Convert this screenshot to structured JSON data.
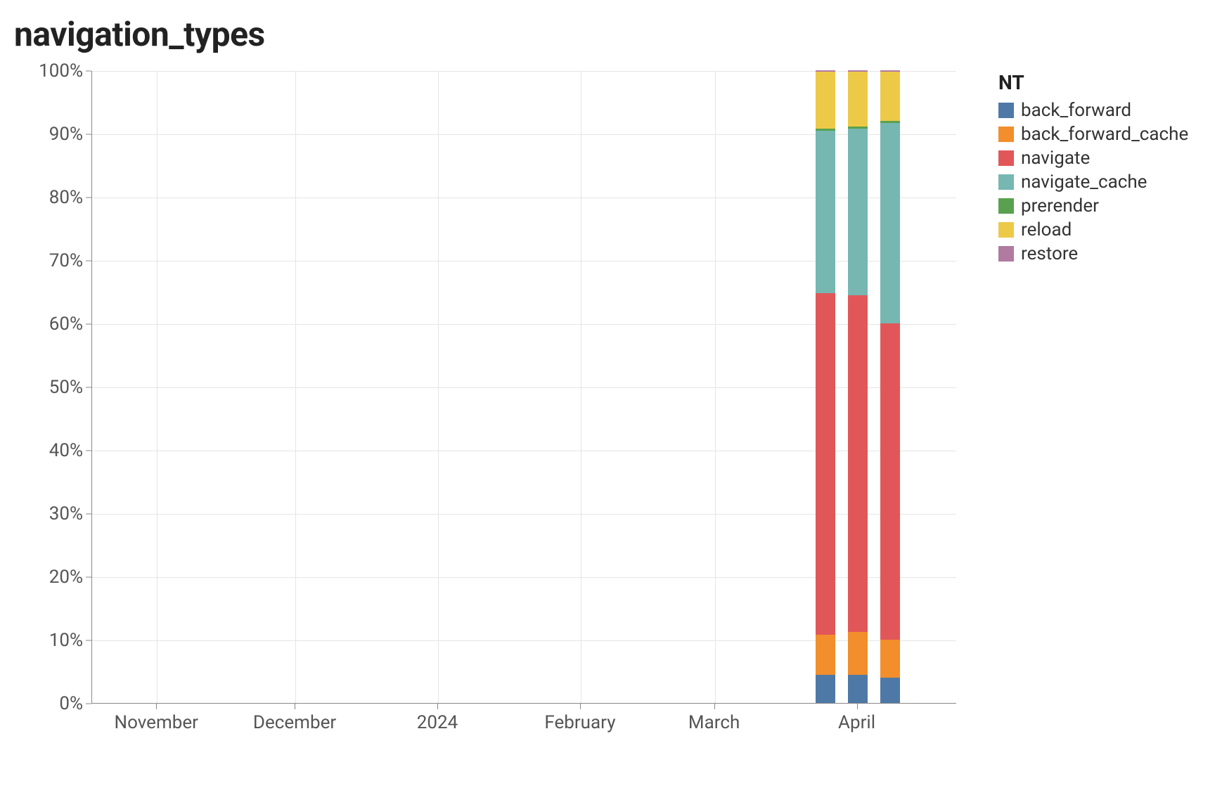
{
  "chart_data": {
    "type": "bar",
    "title": "navigation_types",
    "ylabel": "",
    "xlabel": "",
    "ylim": [
      0,
      100
    ],
    "y_ticks": [
      0,
      10,
      20,
      30,
      40,
      50,
      60,
      70,
      80,
      90,
      100
    ],
    "y_tick_labels": [
      "0%",
      "10%",
      "20%",
      "30%",
      "40%",
      "50%",
      "60%",
      "70%",
      "80%",
      "90%",
      "100%"
    ],
    "x_ticks": [
      {
        "pos": 0.075,
        "label": "November"
      },
      {
        "pos": 0.235,
        "label": "December"
      },
      {
        "pos": 0.4,
        "label": "2024"
      },
      {
        "pos": 0.565,
        "label": "February"
      },
      {
        "pos": 0.72,
        "label": "March"
      },
      {
        "pos": 0.885,
        "label": "April"
      }
    ],
    "legend_title": "NT",
    "series": [
      {
        "name": "back_forward",
        "color": "#4e79a7"
      },
      {
        "name": "back_forward_cache",
        "color": "#f28e2b"
      },
      {
        "name": "navigate",
        "color": "#e15759"
      },
      {
        "name": "navigate_cache",
        "color": "#76b7b2"
      },
      {
        "name": "prerender",
        "color": "#59a14f"
      },
      {
        "name": "reload",
        "color": "#edc948"
      },
      {
        "name": "restore",
        "color": "#b07aa1"
      }
    ],
    "bars": [
      {
        "x_pos": 0.848,
        "segments": {
          "back_forward": 4.5,
          "back_forward_cache": 6.3,
          "navigate": 54.0,
          "navigate_cache": 25.7,
          "prerender": 0.3,
          "reload": 9.0,
          "restore": 0.2
        }
      },
      {
        "x_pos": 0.885,
        "segments": {
          "back_forward": 4.5,
          "back_forward_cache": 6.7,
          "navigate": 53.3,
          "navigate_cache": 26.3,
          "prerender": 0.3,
          "reload": 8.7,
          "restore": 0.2
        }
      },
      {
        "x_pos": 0.923,
        "segments": {
          "back_forward": 4.0,
          "back_forward_cache": 6.0,
          "navigate": 50.0,
          "navigate_cache": 31.7,
          "prerender": 0.3,
          "reload": 7.8,
          "restore": 0.2
        }
      }
    ]
  }
}
